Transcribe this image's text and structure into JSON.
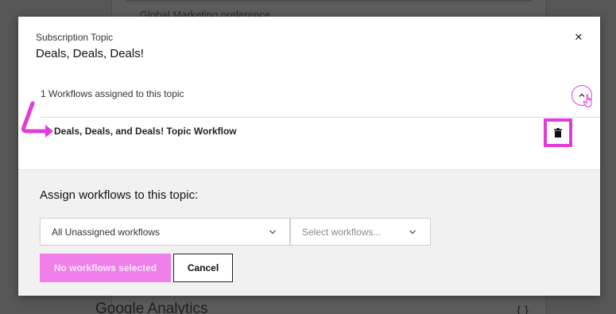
{
  "background": {
    "top_item": "Global Marketing preference",
    "bottom_heading": "Google Analytics",
    "bottom_right_text": "{ }"
  },
  "modal": {
    "eyebrow": "Subscription Topic",
    "title": "Deals, Deals, Deals!",
    "close_icon": "close-icon",
    "assigned_count_text": "1 Workflows assigned to this topic",
    "collapse_icon": "chevron-up-icon",
    "workflows": [
      {
        "name": "Deals, Deals, and Deals! Topic Workflow",
        "action_icon": "trash-icon"
      }
    ],
    "assign": {
      "title": "Assign workflows to this topic:",
      "filter_value": "All Unassigned workflows",
      "workflows_placeholder": "Select workflows...",
      "primary_button": "No workflows selected",
      "cancel_button": "Cancel"
    }
  },
  "colors": {
    "highlight": "#e23bd8",
    "primary_disabled": "#f07fea"
  }
}
